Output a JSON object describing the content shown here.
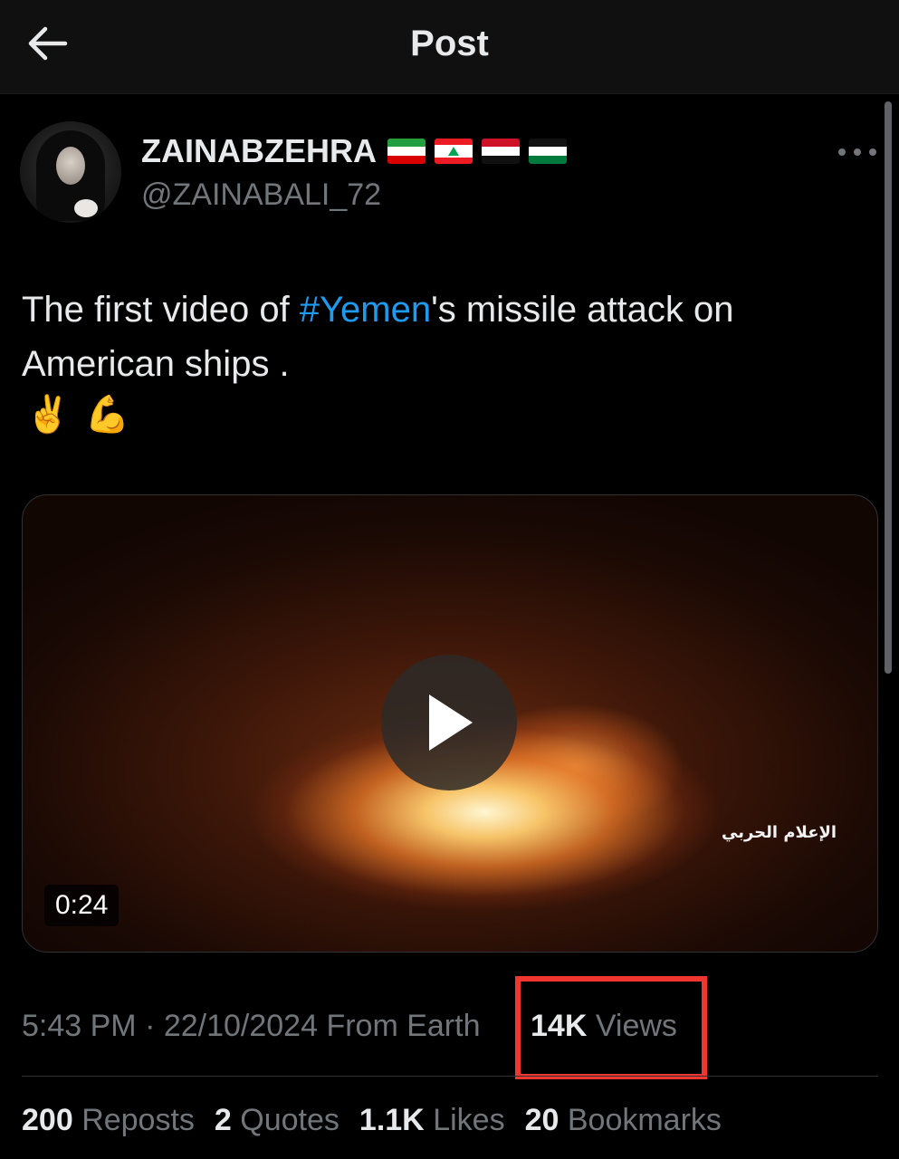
{
  "header": {
    "title": "Post"
  },
  "author": {
    "display_name": "ZAINABZEHRA",
    "flags": [
      "Iran",
      "Lebanon",
      "Yemen",
      "Palestine"
    ],
    "handle": "@ZAINABALI_72"
  },
  "post": {
    "text_before": "The first video of ",
    "hashtag": "#Yemen",
    "text_after": "'s missile attack on American ships .",
    "emojis": [
      "✌️",
      "💪"
    ]
  },
  "media": {
    "duration": "0:24",
    "watermark": "الإعلام الحربي"
  },
  "meta": {
    "timestamp": "5:43 PM · 22/10/2024 From Earth",
    "views_count": "14K",
    "views_label": "Views"
  },
  "stats": [
    {
      "count": "200",
      "label": "Reposts"
    },
    {
      "count": "2",
      "label": "Quotes"
    },
    {
      "count": "1.1K",
      "label": "Likes"
    },
    {
      "count": "20",
      "label": "Bookmarks"
    }
  ],
  "colors": {
    "background": "#000000",
    "header_bg": "#101010",
    "text": "#e7e9ea",
    "muted": "#71767b",
    "link": "#1d9bf0",
    "highlight": "#f0362f"
  }
}
